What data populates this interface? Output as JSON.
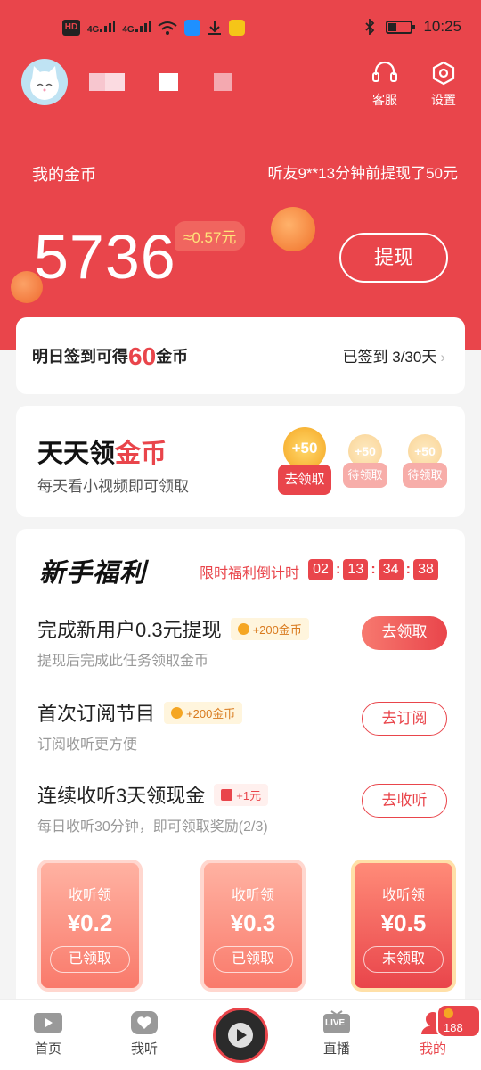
{
  "status_bar": {
    "left_chips": [
      "HD",
      "4G",
      "4G"
    ],
    "time": "10:25"
  },
  "profile": {
    "avatar_icon": "cat-avatar-icon"
  },
  "top_actions": {
    "service_label": "客服",
    "settings_label": "设置"
  },
  "coins": {
    "label": "我的金币",
    "news": "听友9**13分钟前提现了50元",
    "value": "5736",
    "money": "≈0.57元",
    "withdraw_label": "提现"
  },
  "signin": {
    "prefix": "明日签到可得",
    "amount": "60",
    "suffix": "金币",
    "status": "已签到 3/30天",
    "chevron": "›"
  },
  "daily": {
    "title_black": "天天领",
    "title_red": "金币",
    "subtitle": "每天看小视频即可领取",
    "gifts": [
      {
        "amount": "+50",
        "state": "去领取"
      },
      {
        "amount": "+50",
        "state": "待领取"
      },
      {
        "amount": "+50",
        "state": "待领取"
      }
    ]
  },
  "newbie": {
    "title": "新手福利",
    "countdown_label": "限时福利倒计时",
    "countdown": [
      "02",
      "13",
      "34",
      "38"
    ],
    "tasks": [
      {
        "title": "完成新用户0.3元提现",
        "badge": "+200金币",
        "sub": "提现后完成此任务领取金币",
        "button": "去领取"
      },
      {
        "title": "首次订阅节目",
        "badge": "+200金币",
        "sub": "订阅收听更方便",
        "button": "去订阅"
      },
      {
        "title": "连续收听3天领现金",
        "badge": "+1元",
        "sub": "每日收听30分钟，即可领取奖励(2/3)",
        "button": "去收听"
      }
    ],
    "rewards": [
      {
        "label": "收听领",
        "amount": "¥0.2",
        "state": "已领取"
      },
      {
        "label": "收听领",
        "amount": "¥0.3",
        "state": "已领取"
      },
      {
        "label": "收听领",
        "amount": "¥0.5",
        "state": "未领取"
      }
    ]
  },
  "nav": {
    "home": "首页",
    "listen": "我听",
    "live": "直播",
    "live_badge": "LIVE",
    "mine": "我的",
    "mine_badge": "188"
  },
  "colors": {
    "brand_red": "#e9454b",
    "gold": "#f5a623"
  }
}
